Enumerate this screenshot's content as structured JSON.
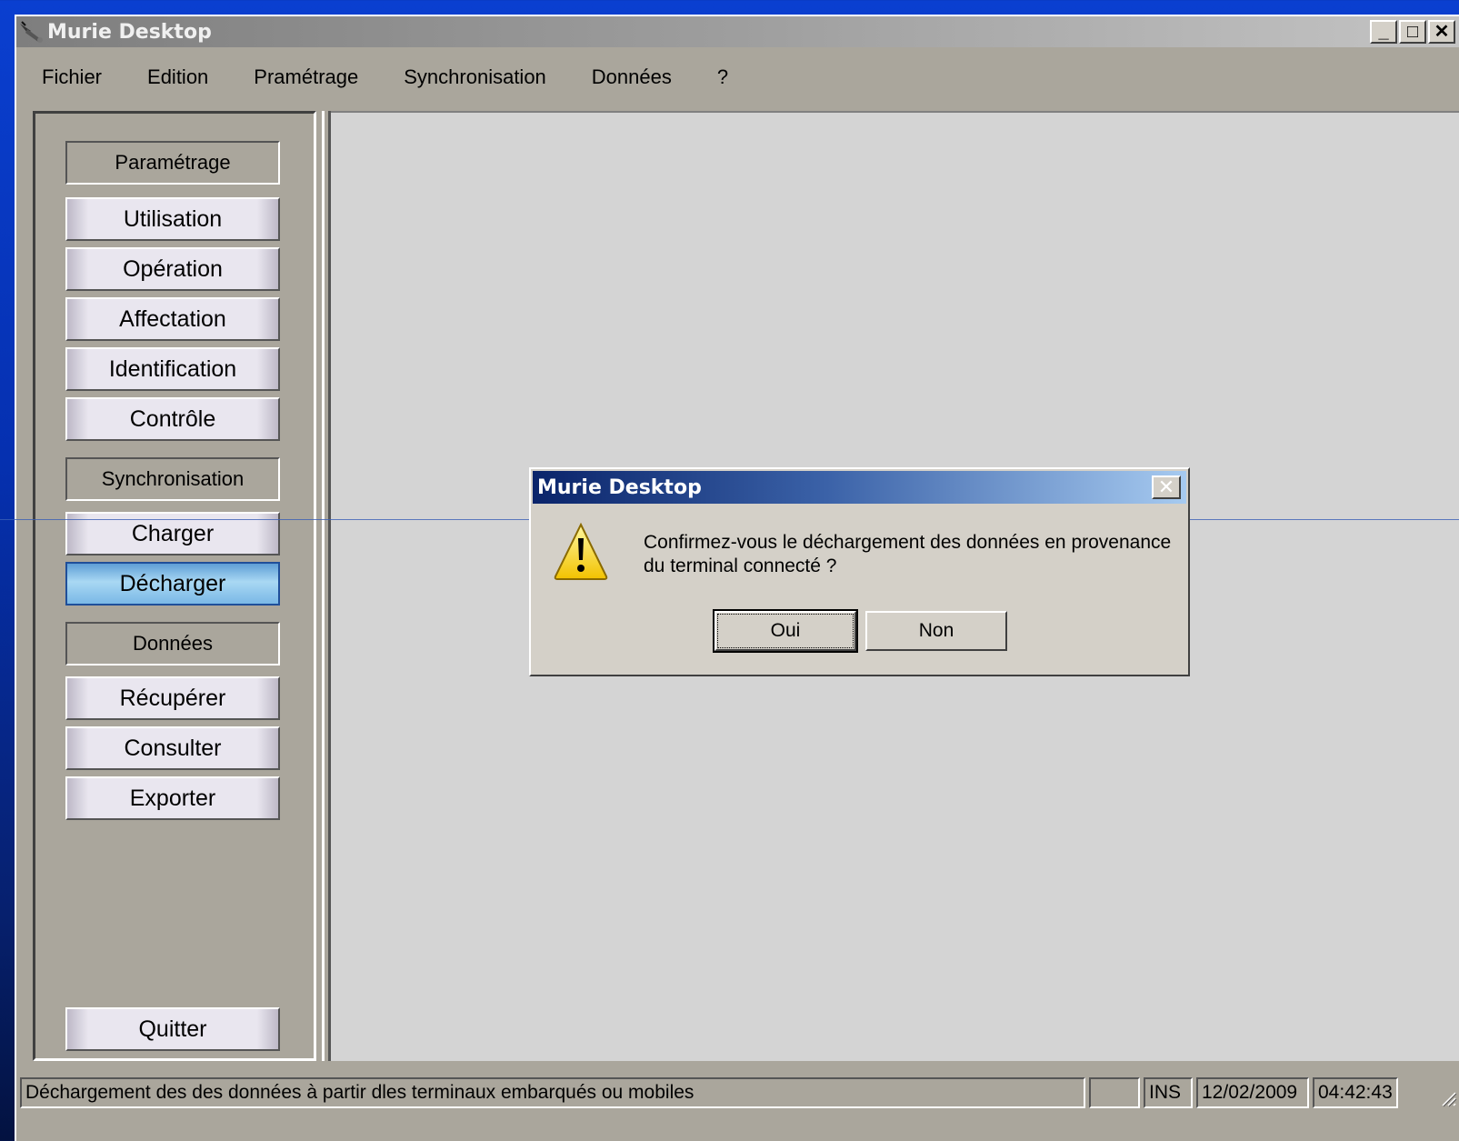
{
  "window": {
    "title": "Murie Desktop",
    "minimize": "_",
    "maximize": "□",
    "close": "✕"
  },
  "menu": [
    "Fichier",
    "Edition",
    "Pramétrage",
    "Synchronisation",
    "Données",
    "?"
  ],
  "sidebar": {
    "section_parametrage": "Paramétrage",
    "section_synchronisation": "Synchronisation",
    "section_donnees": "Données",
    "buttons": {
      "utilisation": "Utilisation",
      "operation": "Opération",
      "affectation": "Affectation",
      "identification": "Identification",
      "controle": "Contrôle",
      "charger": "Charger",
      "decharger": "Décharger",
      "recuperer": "Récupérer",
      "consulter": "Consulter",
      "exporter": "Exporter",
      "quitter": "Quitter"
    }
  },
  "dialog": {
    "title": "Murie Desktop",
    "message": "Confirmez-vous le déchargement des données en provenance du terminal connecté ?",
    "yes": "Oui",
    "no": "Non",
    "icon": "warning-icon"
  },
  "status": {
    "message": "Déchargement des des données à partir dles terminaux embarqués ou mobiles",
    "empty": "",
    "ins": "INS",
    "date": "12/02/2009",
    "time": "04:42:43"
  },
  "colors": {
    "desktop": "#0a3fd0",
    "window": "#aaa69c",
    "workspace": "#d4d4d4",
    "active_button": "#7ab8e6",
    "dialog_title": "#0a246a"
  }
}
